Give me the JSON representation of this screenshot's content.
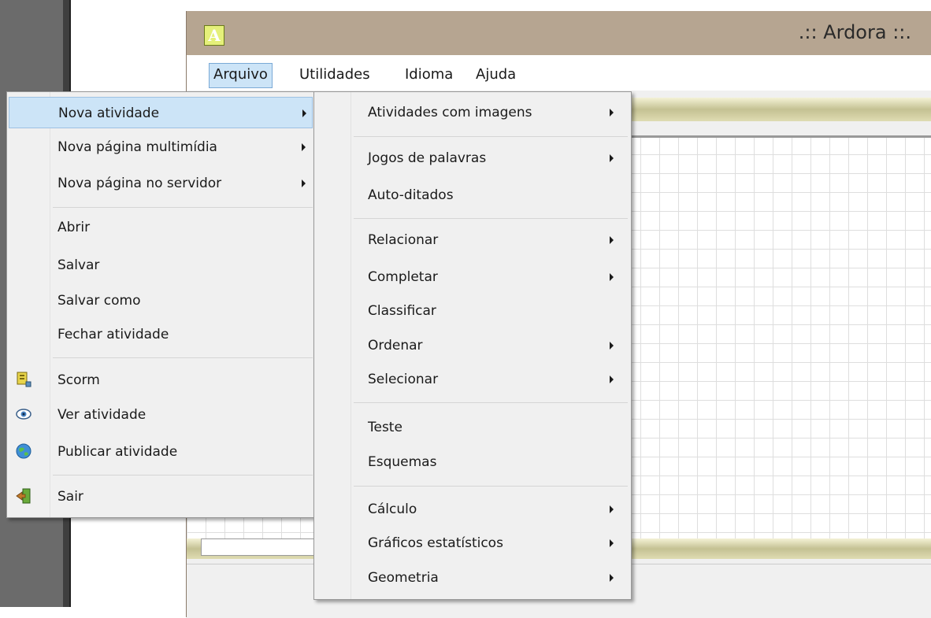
{
  "window": {
    "logo": "A",
    "title": ".:: Ardora ::."
  },
  "menubar": {
    "items": [
      "Arquivo",
      "Utilidades",
      "Idioma",
      "Ajuda"
    ]
  },
  "file_menu": {
    "new_activity": "Nova atividade",
    "new_multimedia_page": "Nova página multimídia",
    "new_server_page": "Nova página no servidor",
    "open": "Abrir",
    "save": "Salvar",
    "save_as": "Salvar como",
    "close_activity": "Fechar atividade",
    "scorm": "Scorm",
    "view_activity": "Ver atividade",
    "publish_activity": "Publicar atividade",
    "exit": "Sair",
    "icons": {
      "scorm": "scorm-package-icon",
      "view": "eye-icon",
      "publish": "globe-icon",
      "exit": "exit-door-icon"
    }
  },
  "activity_submenu": {
    "image_activities": "Atividades com imagens",
    "word_games": "Jogos de palavras",
    "auto_dictation": "Auto-ditados",
    "relate": "Relacionar",
    "complete": "Completar",
    "classify": "Classificar",
    "order": "Ordenar",
    "select": "Selecionar",
    "test": "Teste",
    "schemes": "Esquemas",
    "calculation": "Cálculo",
    "statistical_charts": "Gráficos estatísticos",
    "geometry": "Geometria"
  },
  "colors": {
    "titlebar": "#b6a591",
    "menu_highlight": "#cce4f7",
    "menu_background": "#f0f0f0"
  }
}
